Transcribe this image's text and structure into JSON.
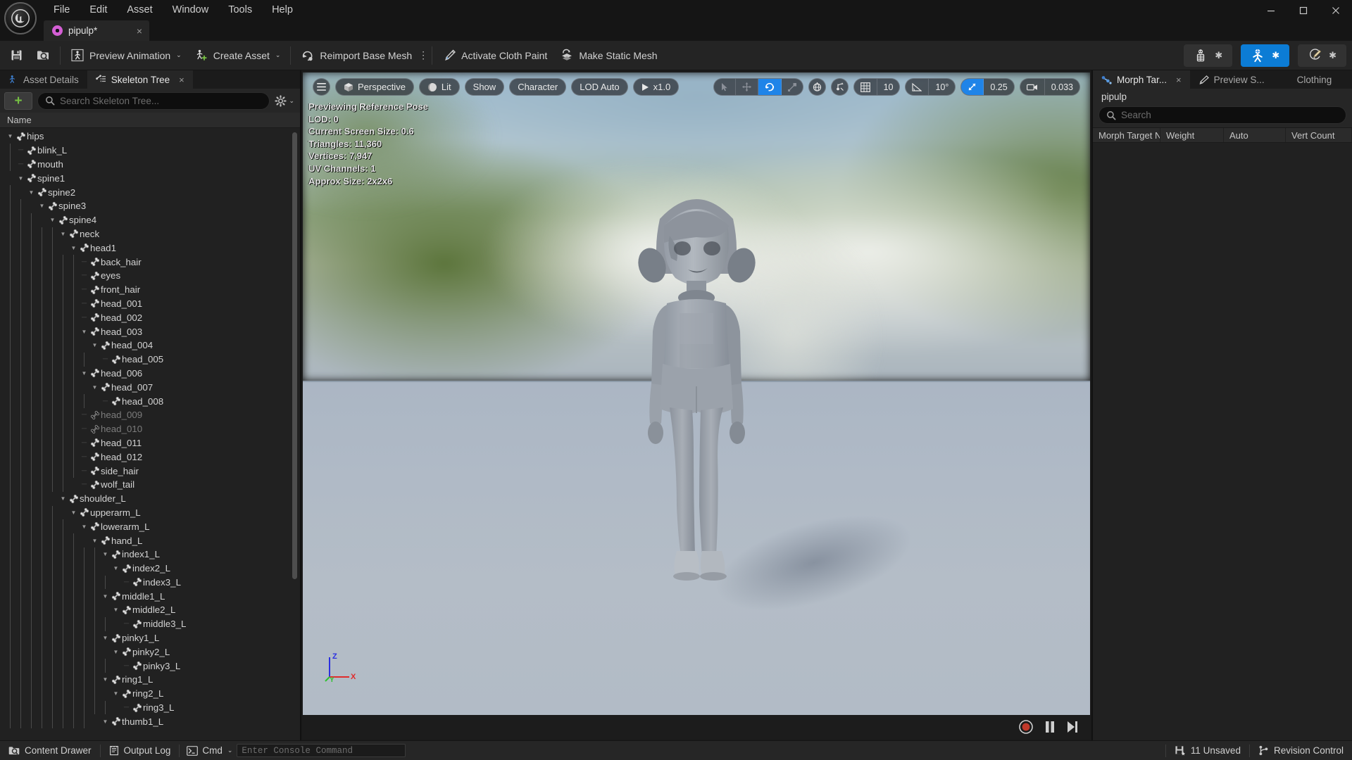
{
  "window": {
    "logo_icon": "unreal-engine-logo",
    "menus": [
      "File",
      "Edit",
      "Asset",
      "Window",
      "Tools",
      "Help"
    ],
    "controls": {
      "minimize": "minimize-icon",
      "maximize": "maximize-icon",
      "close": "close-icon"
    },
    "document_tab": {
      "label": "pipulp*",
      "icon": "skeletal-mesh-asset-icon",
      "close": "×"
    }
  },
  "toolbar": {
    "save_icon": "save-icon",
    "browse_icon": "browse-content-icon",
    "preview_animation": {
      "label": "Preview Animation",
      "icon": "preview-animation-icon",
      "caret": "⌄"
    },
    "create_asset": {
      "label": "Create Asset",
      "icon": "create-asset-icon",
      "caret": "⌄"
    },
    "reimport_base_mesh": {
      "label": "Reimport Base Mesh",
      "icon": "reimport-icon",
      "kebab": "⋮"
    },
    "activate_cloth_paint": {
      "label": "Activate Cloth Paint",
      "icon": "cloth-paint-brush-icon"
    },
    "make_static_mesh": {
      "label": "Make Static Mesh",
      "icon": "static-mesh-icon"
    },
    "modes": [
      {
        "name": "skeleton-mode",
        "icon": "skeleton-icon",
        "star": "✱",
        "active": false
      },
      {
        "name": "mesh-mode",
        "icon": "skeletal-mesh-icon",
        "star": "✱",
        "active": true
      },
      {
        "name": "paint-mode",
        "icon": "paint-brush-icon",
        "star": "✱",
        "active": false
      }
    ],
    "accent_color": "#0c7cd5"
  },
  "left_panel": {
    "tabs": [
      {
        "label": "Asset Details",
        "icon": "asset-details-icon",
        "active": false,
        "closable": false
      },
      {
        "label": "Skeleton Tree",
        "icon": "skeleton-tree-icon",
        "active": true,
        "closable": true
      }
    ],
    "add_button": "+",
    "search": {
      "placeholder": "Search Skeleton Tree...",
      "value": "",
      "icon": "search-icon"
    },
    "settings_icon": "gear-icon",
    "settings_caret": "⌄",
    "column_header": "Name",
    "tree": [
      {
        "label": "hips",
        "depth": 0,
        "expanded": true,
        "dim": false
      },
      {
        "label": "blink_L",
        "depth": 1,
        "expanded": null,
        "dim": false
      },
      {
        "label": "mouth",
        "depth": 1,
        "expanded": null,
        "dim": false
      },
      {
        "label": "spine1",
        "depth": 1,
        "expanded": true,
        "dim": false
      },
      {
        "label": "spine2",
        "depth": 2,
        "expanded": true,
        "dim": false
      },
      {
        "label": "spine3",
        "depth": 3,
        "expanded": true,
        "dim": false
      },
      {
        "label": "spine4",
        "depth": 4,
        "expanded": true,
        "dim": false
      },
      {
        "label": "neck",
        "depth": 5,
        "expanded": true,
        "dim": false
      },
      {
        "label": "head1",
        "depth": 6,
        "expanded": true,
        "dim": false
      },
      {
        "label": "back_hair",
        "depth": 7,
        "expanded": null,
        "dim": false
      },
      {
        "label": "eyes",
        "depth": 7,
        "expanded": null,
        "dim": false
      },
      {
        "label": "front_hair",
        "depth": 7,
        "expanded": null,
        "dim": false
      },
      {
        "label": "head_001",
        "depth": 7,
        "expanded": null,
        "dim": false
      },
      {
        "label": "head_002",
        "depth": 7,
        "expanded": null,
        "dim": false
      },
      {
        "label": "head_003",
        "depth": 7,
        "expanded": true,
        "dim": false
      },
      {
        "label": "head_004",
        "depth": 8,
        "expanded": true,
        "dim": false
      },
      {
        "label": "head_005",
        "depth": 9,
        "expanded": null,
        "dim": false
      },
      {
        "label": "head_006",
        "depth": 7,
        "expanded": true,
        "dim": false
      },
      {
        "label": "head_007",
        "depth": 8,
        "expanded": true,
        "dim": false
      },
      {
        "label": "head_008",
        "depth": 9,
        "expanded": null,
        "dim": false
      },
      {
        "label": "head_009",
        "depth": 7,
        "expanded": null,
        "dim": true
      },
      {
        "label": "head_010",
        "depth": 7,
        "expanded": null,
        "dim": true
      },
      {
        "label": "head_011",
        "depth": 7,
        "expanded": null,
        "dim": false
      },
      {
        "label": "head_012",
        "depth": 7,
        "expanded": null,
        "dim": false
      },
      {
        "label": "side_hair",
        "depth": 7,
        "expanded": null,
        "dim": false
      },
      {
        "label": "wolf_tail",
        "depth": 7,
        "expanded": null,
        "dim": false
      },
      {
        "label": "shoulder_L",
        "depth": 5,
        "expanded": true,
        "dim": false
      },
      {
        "label": "upperarm_L",
        "depth": 6,
        "expanded": true,
        "dim": false
      },
      {
        "label": "lowerarm_L",
        "depth": 7,
        "expanded": true,
        "dim": false
      },
      {
        "label": "hand_L",
        "depth": 8,
        "expanded": true,
        "dim": false
      },
      {
        "label": "index1_L",
        "depth": 9,
        "expanded": true,
        "dim": false
      },
      {
        "label": "index2_L",
        "depth": 10,
        "expanded": true,
        "dim": false
      },
      {
        "label": "index3_L",
        "depth": 11,
        "expanded": null,
        "dim": false
      },
      {
        "label": "middle1_L",
        "depth": 9,
        "expanded": true,
        "dim": false
      },
      {
        "label": "middle2_L",
        "depth": 10,
        "expanded": true,
        "dim": false
      },
      {
        "label": "middle3_L",
        "depth": 11,
        "expanded": null,
        "dim": false
      },
      {
        "label": "pinky1_L",
        "depth": 9,
        "expanded": true,
        "dim": false
      },
      {
        "label": "pinky2_L",
        "depth": 10,
        "expanded": true,
        "dim": false
      },
      {
        "label": "pinky3_L",
        "depth": 11,
        "expanded": null,
        "dim": false
      },
      {
        "label": "ring1_L",
        "depth": 9,
        "expanded": true,
        "dim": false
      },
      {
        "label": "ring2_L",
        "depth": 10,
        "expanded": true,
        "dim": false
      },
      {
        "label": "ring3_L",
        "depth": 11,
        "expanded": null,
        "dim": false
      },
      {
        "label": "thumb1_L",
        "depth": 9,
        "expanded": true,
        "dim": false
      }
    ]
  },
  "viewport": {
    "menu_icon": "viewport-menu-icon",
    "left_controls": [
      {
        "name": "camera-mode",
        "label": "Perspective",
        "icon": "cube-icon"
      },
      {
        "name": "view-mode",
        "label": "Lit",
        "icon": "lit-sphere-icon"
      },
      {
        "name": "show-menu",
        "label": "Show",
        "icon": ""
      },
      {
        "name": "character-menu",
        "label": "Character",
        "icon": ""
      },
      {
        "name": "lod-menu",
        "label": "LOD Auto",
        "icon": ""
      },
      {
        "name": "playback-speed",
        "label": "x1.0",
        "icon": "play-icon"
      }
    ],
    "transform_tools": [
      {
        "name": "select-tool",
        "icon": "cursor-icon",
        "state": "off"
      },
      {
        "name": "translate-tool",
        "icon": "move-icon",
        "state": "off"
      },
      {
        "name": "rotate-tool",
        "icon": "rotate-icon",
        "state": "on"
      },
      {
        "name": "scale-tool",
        "icon": "scale-icon",
        "state": "off"
      }
    ],
    "coord_system_icon": "world-coordinate-icon",
    "surface_snap_icon": "surface-snap-icon",
    "grid_snap": {
      "icon": "grid-icon",
      "value": "10"
    },
    "angle_snap": {
      "icon": "angle-icon",
      "value": "10°"
    },
    "scale_snap": {
      "icon": "scale-snap-icon",
      "value": "0.25",
      "active": true
    },
    "camera_speed": {
      "icon": "camera-icon",
      "value": "0.033"
    },
    "stats": {
      "title": "Previewing Reference Pose",
      "lines": [
        "LOD: 0",
        "Current Screen Size: 0.6",
        "Triangles: 11,360",
        "Vertices: 7,947",
        "UV Channels: 1",
        "Approx Size: 2x2x6"
      ]
    },
    "axis_gizmo": {
      "z": "Z",
      "y": "Y",
      "x": "X",
      "z_color": "#2b30e0",
      "y_color": "#2fc22f",
      "x_color": "#e02b2b"
    },
    "playback": [
      {
        "name": "record-button",
        "icon": "record-icon"
      },
      {
        "name": "pause-button",
        "icon": "pause-icon"
      },
      {
        "name": "step-forward-button",
        "icon": "step-forward-icon"
      }
    ]
  },
  "right_panel": {
    "tabs": [
      {
        "label": "Morph Tar...",
        "icon": "morph-target-icon",
        "active": true,
        "closable": true
      },
      {
        "label": "Preview S...",
        "icon": "preview-scene-icon",
        "active": false,
        "closable": false
      },
      {
        "label": "Clothing",
        "icon": "",
        "active": false,
        "closable": false
      }
    ],
    "asset_name": "pipulp",
    "search": {
      "placeholder": "Search",
      "value": "",
      "icon": "search-icon"
    },
    "columns": [
      "Morph Target N",
      "Weight",
      "Auto",
      "Vert Count"
    ],
    "rows": []
  },
  "statusbar": {
    "content_drawer": {
      "label": "Content Drawer",
      "icon": "content-drawer-icon"
    },
    "output_log": {
      "label": "Output Log",
      "icon": "output-log-icon"
    },
    "cmd": {
      "label": "Cmd",
      "icon": "console-icon",
      "caret": "⌄"
    },
    "console": {
      "placeholder": "Enter Console Command",
      "value": ""
    },
    "unsaved": {
      "label": "11 Unsaved",
      "icon": "unsaved-icon"
    },
    "revision_control": {
      "label": "Revision Control",
      "icon": "revision-control-icon"
    }
  }
}
